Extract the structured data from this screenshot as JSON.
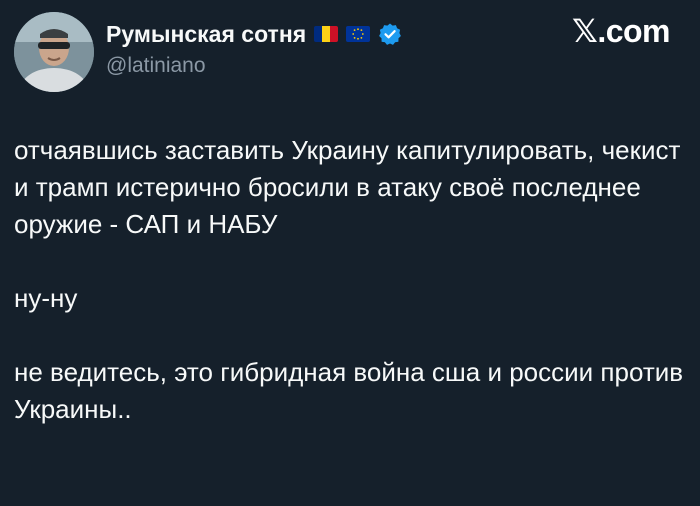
{
  "author": {
    "display_name": "Румынская сотня",
    "handle": "@latiniano",
    "flags": [
      "romania-flag",
      "eu-flag"
    ],
    "verified": true,
    "verified_color": "#1d9bf0"
  },
  "brand": {
    "label": "𝕏.com"
  },
  "tweet": {
    "paragraphs": [
      "отчаявшись заставить Украину капитулировать, чекист и трамп истерично бросили в атаку своё последнее оружие - САП и НАБУ",
      "ну-ну",
      "не ведитесь, это гибридная война сша и россии против Украины.."
    ]
  },
  "colors": {
    "background": "#15202b",
    "text": "#f7f9f9",
    "secondary_text": "#8b98a5"
  }
}
